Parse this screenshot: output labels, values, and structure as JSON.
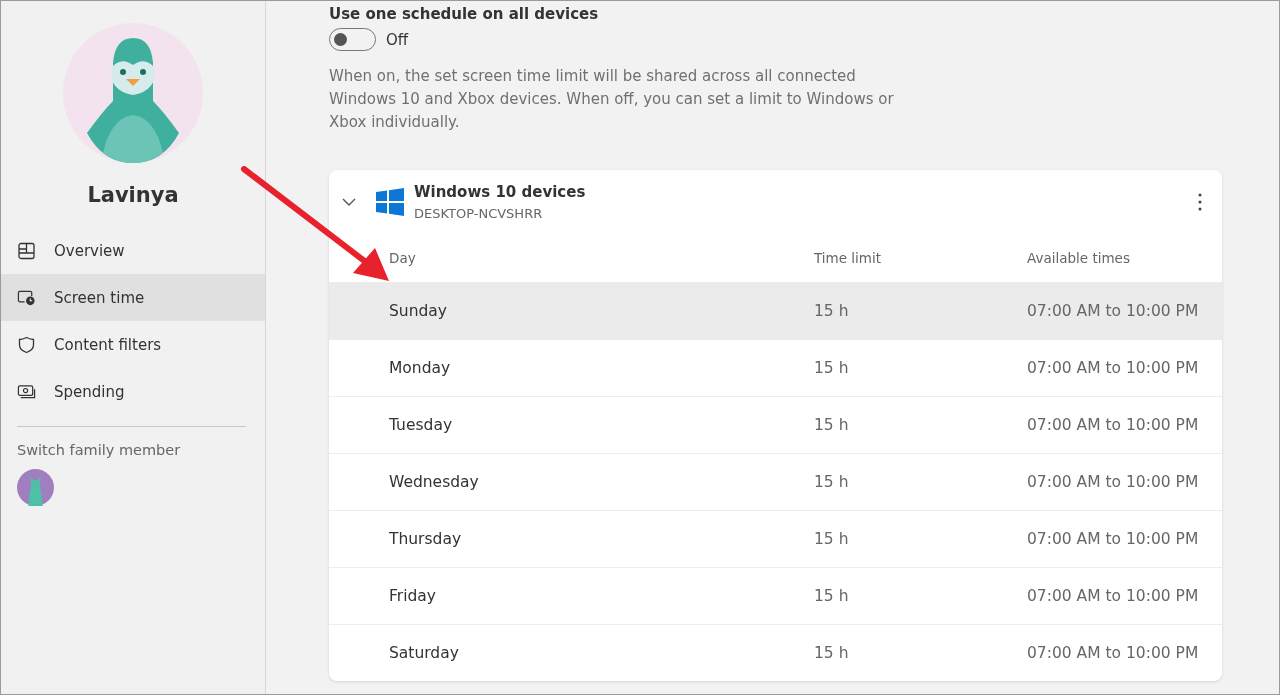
{
  "sidebar": {
    "profile_name": "Lavinya",
    "items": [
      {
        "label": "Overview",
        "kind": "overview",
        "selected": false
      },
      {
        "label": "Screen time",
        "kind": "screen",
        "selected": true
      },
      {
        "label": "Content filters",
        "kind": "shield",
        "selected": false
      },
      {
        "label": "Spending",
        "kind": "money",
        "selected": false
      }
    ],
    "switch_label": "Switch family member"
  },
  "schedule": {
    "title": "Use one schedule on all devices",
    "toggle": {
      "on": false,
      "label": "Off"
    },
    "description": "When on, the set screen time limit will be shared across all connected Windows 10 and Xbox devices. When off, you can set a limit to Windows or Xbox individually."
  },
  "device_card": {
    "title": "Windows 10 devices",
    "subtitle": "DESKTOP-NCVSHRR",
    "expanded": true,
    "columns": [
      "Day",
      "Time limit",
      "Available times"
    ],
    "rows": [
      {
        "day": "Sunday",
        "limit": "15 h",
        "times": "07:00 AM to 10:00 PM",
        "selected": true
      },
      {
        "day": "Monday",
        "limit": "15 h",
        "times": "07:00 AM to 10:00 PM",
        "selected": false
      },
      {
        "day": "Tuesday",
        "limit": "15 h",
        "times": "07:00 AM to 10:00 PM",
        "selected": false
      },
      {
        "day": "Wednesday",
        "limit": "15 h",
        "times": "07:00 AM to 10:00 PM",
        "selected": false
      },
      {
        "day": "Thursday",
        "limit": "15 h",
        "times": "07:00 AM to 10:00 PM",
        "selected": false
      },
      {
        "day": "Friday",
        "limit": "15 h",
        "times": "07:00 AM to 10:00 PM",
        "selected": false
      },
      {
        "day": "Saturday",
        "limit": "15 h",
        "times": "07:00 AM to 10:00 PM",
        "selected": false
      }
    ]
  }
}
